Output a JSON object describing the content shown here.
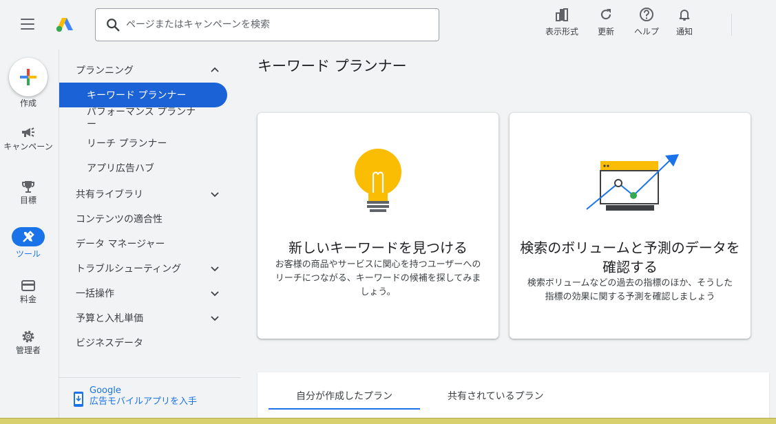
{
  "search": {
    "placeholder": "ページまたはキャンペーンを検索"
  },
  "toolbar": {
    "view_label": "表示形式",
    "refresh_label": "更新",
    "help_label": "ヘルプ",
    "notify_label": "通知"
  },
  "rail": {
    "create": "作成",
    "campaign": "キャンペーン",
    "goals": "目標",
    "tools": "ツール",
    "billing": "料金",
    "admin": "管理者"
  },
  "nav": {
    "planning": "プランニング",
    "keyword_planner": "キーワード プランナー",
    "performance_planner": "パフォーマンス プランナー",
    "reach_planner": "リーチ プランナー",
    "app_hub": "アプリ広告ハブ",
    "shared_library": "共有ライブラリ",
    "content_suitability": "コンテンツの適合性",
    "data_manager": "データ マネージャー",
    "troubleshooting": "トラブルシューティング",
    "bulk_actions": "一括操作",
    "budgets_bids": "予算と入札単価",
    "business_data": "ビジネスデータ"
  },
  "mobile": {
    "line1": "Google",
    "line2": "広告モバイルアプリを入手"
  },
  "page": {
    "title": "キーワード プランナー"
  },
  "cards": [
    {
      "title": "新しいキーワードを見つける",
      "desc": "お客様の商品やサービスに関心を持つユーザーへのリーチにつながる、キーワードの候補を探してみましょう。"
    },
    {
      "title": "検索のボリュームと予測のデータを確認する",
      "desc": "検索ボリュームなどの過去の指標のほか、そうした指標の効果に関する予測を確認しましょう"
    }
  ],
  "tabs": {
    "mine": "自分が作成したプラン",
    "shared": "共有されているプラン"
  },
  "colors": {
    "accent": "#1a73e8",
    "active_nav": "#1a62d6",
    "bulb": "#fbbc04",
    "green": "#34a853"
  }
}
